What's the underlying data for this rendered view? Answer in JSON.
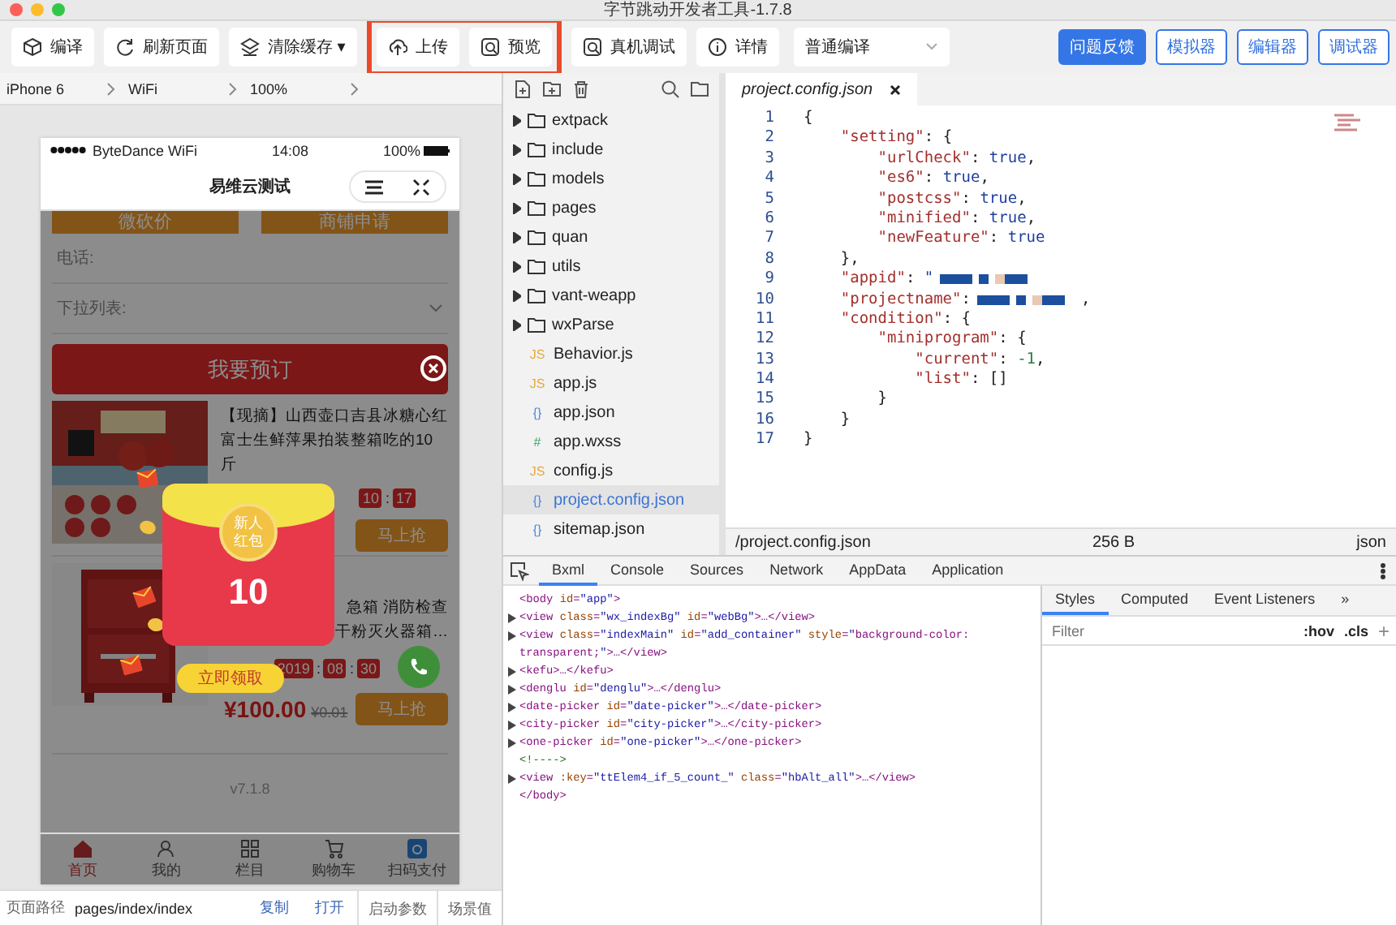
{
  "window": {
    "title": "字节跳动开发者工具-1.7.8"
  },
  "toolbar": {
    "groups": [
      {
        "highlighted": false,
        "buttons": [
          {
            "label": "编译",
            "kind": "cube"
          },
          {
            "label": "刷新页面",
            "kind": "refresh"
          },
          {
            "label": "清除缓存 ▾",
            "kind": "stack"
          }
        ]
      },
      {
        "highlighted": true,
        "buttons": [
          {
            "label": "上传",
            "kind": "upload"
          },
          {
            "label": "预览",
            "kind": "preview"
          }
        ]
      },
      {
        "highlighted": false,
        "buttons": [
          {
            "label": "真机调试",
            "kind": "preview"
          },
          {
            "label": "详情",
            "kind": "info"
          }
        ]
      }
    ],
    "compile_select": {
      "value": "普通编译"
    },
    "right_buttons": [
      {
        "label": "问题反馈",
        "primary": true
      },
      {
        "label": "模拟器",
        "primary": false
      },
      {
        "label": "编辑器",
        "primary": false
      },
      {
        "label": "调试器",
        "primary": false
      }
    ]
  },
  "simulator": {
    "device": "iPhone 6",
    "network": "WiFi",
    "zoom": "100%",
    "status_bar": {
      "carrier": "ByteDance WiFi",
      "time": "14:08",
      "battery": "100%"
    },
    "nav_title": "易维云测试",
    "page": {
      "top_buttons": [
        "微砍价",
        "商铺申请"
      ],
      "phone_label": "电话:",
      "dropdown_label": "下拉列表:",
      "book_button": "我要预订",
      "products": [
        {
          "title": "【现摘】山西壶口吉县冰糖心红富士生鲜萍果拍装整箱吃的10斤",
          "countdown": [
            "10",
            ":",
            "17"
          ],
          "buy": "马上抢"
        },
        {
          "title_lines": [
            "急箱 消防检查",
            "干粉灭火器箱…"
          ],
          "countdown": [
            "2019",
            ":",
            "08",
            ":",
            "30"
          ],
          "price": "¥100.00",
          "old_price": "¥0.01",
          "buy": "马上抢"
        }
      ],
      "version": "v7.1.8"
    },
    "red_packet": {
      "badge": "新人红包",
      "amount": "10",
      "claim": "立即领取"
    },
    "tabbar": [
      {
        "label": "首页",
        "kind": "home",
        "selected": true
      },
      {
        "label": "我的",
        "kind": "user",
        "selected": false
      },
      {
        "label": "栏目",
        "kind": "grid",
        "selected": false
      },
      {
        "label": "购物车",
        "kind": "cart",
        "selected": false
      },
      {
        "label": "扫码支付",
        "kind": "pay",
        "selected": false
      }
    ]
  },
  "page_path": {
    "label": "页面路径",
    "value": "pages/index/index",
    "actions": [
      "复制",
      "打开"
    ],
    "tabs": [
      "启动参数",
      "场景值"
    ]
  },
  "file_tree": [
    {
      "name": "extpack",
      "kind": "folder",
      "selected": false
    },
    {
      "name": "include",
      "kind": "folder",
      "selected": false
    },
    {
      "name": "models",
      "kind": "folder",
      "selected": false
    },
    {
      "name": "pages",
      "kind": "folder",
      "selected": false
    },
    {
      "name": "quan",
      "kind": "folder",
      "selected": false
    },
    {
      "name": "utils",
      "kind": "folder",
      "selected": false
    },
    {
      "name": "vant-weapp",
      "kind": "folder",
      "selected": false
    },
    {
      "name": "wxParse",
      "kind": "folder",
      "selected": false
    },
    {
      "name": "Behavior.js",
      "kind": "file",
      "badge": "JS",
      "color": "#e8a83a",
      "selected": false
    },
    {
      "name": "app.js",
      "kind": "file",
      "badge": "JS",
      "color": "#e8a83a",
      "selected": false
    },
    {
      "name": "app.json",
      "kind": "file",
      "badge": "{}",
      "color": "#4a8ad8",
      "selected": false
    },
    {
      "name": "app.wxss",
      "kind": "file",
      "badge": "#",
      "color": "#3aa86a",
      "selected": false
    },
    {
      "name": "config.js",
      "kind": "file",
      "badge": "JS",
      "color": "#e8a83a",
      "selected": false
    },
    {
      "name": "project.config.json",
      "kind": "file",
      "badge": "{}",
      "color": "#4a8ad8",
      "selected": true
    },
    {
      "name": "sitemap.json",
      "kind": "file",
      "badge": "{}",
      "color": "#4a8ad8",
      "selected": false
    }
  ],
  "editor": {
    "tab": "project.config.json",
    "lines": [
      {
        "n": "1",
        "text": "{"
      },
      {
        "n": "2",
        "text": "    \"setting\": {"
      },
      {
        "n": "3",
        "text": "        \"urlCheck\": true,"
      },
      {
        "n": "4",
        "text": "        \"es6\": true,"
      },
      {
        "n": "5",
        "text": "        \"postcss\": true,"
      },
      {
        "n": "6",
        "text": "        \"minified\": true,"
      },
      {
        "n": "7",
        "text": "        \"newFeature\": true"
      },
      {
        "n": "8",
        "text": "    },"
      },
      {
        "n": "9",
        "text": "    \"appid\": \"",
        "redacted": true
      },
      {
        "n": "10",
        "text": "    \"projectname\":",
        "redacted": true,
        "after": ","
      },
      {
        "n": "11",
        "text": "    \"condition\": {"
      },
      {
        "n": "12",
        "text": "        \"miniprogram\": {"
      },
      {
        "n": "13",
        "text": "            \"current\": -1,"
      },
      {
        "n": "14",
        "text": "            \"list\": []"
      },
      {
        "n": "15",
        "text": "        }"
      },
      {
        "n": "16",
        "text": "    }"
      },
      {
        "n": "17",
        "text": "}"
      }
    ],
    "status": {
      "path": "/project.config.json",
      "size": "256 B",
      "lang": "json"
    }
  },
  "devtools": {
    "tabs": [
      {
        "label": "Bxml",
        "selected": true
      },
      {
        "label": "Console",
        "selected": false
      },
      {
        "label": "Sources",
        "selected": false
      },
      {
        "label": "Network",
        "selected": false
      },
      {
        "label": "AppData",
        "selected": false
      },
      {
        "label": "Application",
        "selected": false
      }
    ],
    "dom_lines": [
      {
        "arrow": false,
        "text": "<body id=\"app\">"
      },
      {
        "arrow": true,
        "text": "<view class=\"wx_indexBg\" id=\"webBg\">…</view>"
      },
      {
        "arrow": true,
        "text": "<view class=\"indexMain\" id=\"add_container\" style=\"background-color:"
      },
      {
        "arrow": false,
        "text": "transparent;\">…</view>"
      },
      {
        "arrow": true,
        "text": "<kefu>…</kefu>"
      },
      {
        "arrow": true,
        "text": "<denglu id=\"denglu\">…</denglu>"
      },
      {
        "arrow": true,
        "text": "<date-picker id=\"date-picker\">…</date-picker>"
      },
      {
        "arrow": true,
        "text": "<city-picker id=\"city-picker\">…</city-picker>"
      },
      {
        "arrow": true,
        "text": "<one-picker id=\"one-picker\">…</one-picker>"
      },
      {
        "arrow": false,
        "text": "<!---->"
      },
      {
        "arrow": true,
        "text": "<view :key=\"ttElem4_if_5_count_\" class=\"hbAlt_all\">…</view>"
      },
      {
        "arrow": false,
        "text": "</body>"
      }
    ],
    "styles_tabs": [
      {
        "label": "Styles",
        "selected": true
      },
      {
        "label": "Computed",
        "selected": false
      },
      {
        "label": "Event Listeners",
        "selected": false
      }
    ],
    "more": "»",
    "filter_placeholder": "Filter",
    "hov": ":hov",
    "cls": ".cls",
    "add": "+"
  }
}
